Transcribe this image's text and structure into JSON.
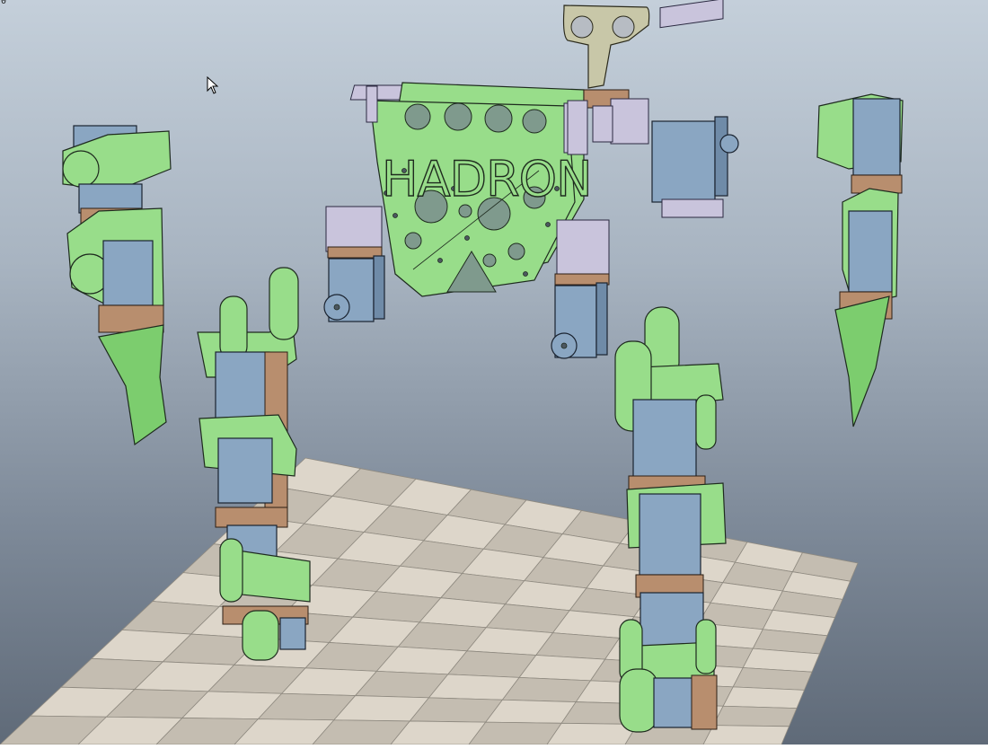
{
  "viewport": {
    "corner_label": "0",
    "title_text": "HADRON"
  },
  "colors": {
    "sky_top": "#c4cfda",
    "sky_bottom": "#5f6a78",
    "plate_green": "#98dd8a",
    "servo_blue": "#8aa6c2",
    "bracket_bronze": "#b88e6e",
    "bracket_lavender": "#c9c4dc",
    "floor_light": "#ddd6ca",
    "floor_dark": "#c4bdb1"
  },
  "icons": {
    "cursor": "mouse-pointer-arrow-icon"
  }
}
